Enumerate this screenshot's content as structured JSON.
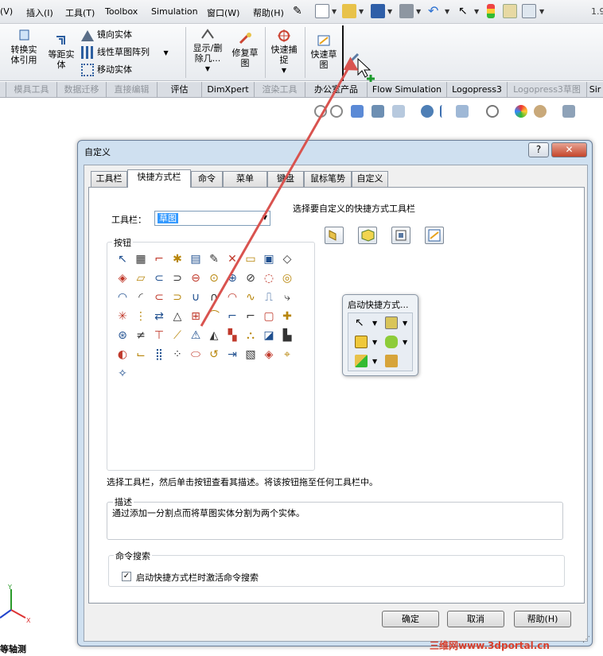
{
  "menubar": {
    "items": [
      "(V)",
      "插入(I)",
      "工具(T)",
      "Toolbox",
      "Simulation",
      "窗口(W)",
      "帮助(H)"
    ],
    "version_text": "1.9"
  },
  "ribbon": {
    "convert_entities": "转换实\n体引用",
    "offset_entities": "等距实\n体",
    "mirror_entities": "镜向实体",
    "linear_pattern": "线性草图阵列",
    "move_entities": "移动实体",
    "show_delete_relations": "显示/删\n除几...",
    "repair_sketch": "修复草\n图",
    "quick_snaps": "快速捕\n捉",
    "rapid_sketch": "快速草\n图"
  },
  "tabs": [
    {
      "label": "模具工具",
      "dim": true
    },
    {
      "label": "数据迁移",
      "dim": true
    },
    {
      "label": "直接编辑",
      "dim": true
    },
    {
      "label": "评估",
      "dim": false
    },
    {
      "label": "DimXpert",
      "dim": false
    },
    {
      "label": "渲染工具",
      "dim": true
    },
    {
      "label": "办公室产品",
      "dim": false
    },
    {
      "label": "Flow Simulation",
      "dim": false
    },
    {
      "label": "Logopress3",
      "dim": false
    },
    {
      "label": "Logopress3草图",
      "dim": true
    },
    {
      "label": "Sir",
      "dim": false
    }
  ],
  "dialog": {
    "title": "自定义",
    "help_btn": "?",
    "close_btn": "✕",
    "tabs": [
      "工具栏",
      "快捷方式栏",
      "命令",
      "菜单",
      "键盘",
      "鼠标笔势",
      "自定义"
    ],
    "active_tab": "快捷方式栏",
    "toolbar_label": "工具栏：",
    "toolbar_value": "草图",
    "select_toolbar_heading": "选择要自定义的快捷方式工具栏",
    "buttons_group": "按钮",
    "popup_title": "启动快捷方式...",
    "hint": "选择工具栏，然后单击按钮查看其描述。将该按钮拖至任何工具栏中。",
    "description_title": "描述",
    "description_text": "通过添加一分割点而将草图实体分割为两个实体。",
    "search_group": "命令搜索",
    "search_checkbox": "启动快捷方式栏时激活命令搜索",
    "search_checked": true,
    "ok": "确定",
    "cancel": "取消",
    "help": "帮助(H)"
  },
  "view": {
    "label": "等轴测"
  },
  "watermark": "三维网www.3dportal.cn",
  "colors": {
    "arrow": "#d9534f",
    "accent": "#3399ff",
    "dialog_frame": "#cfe0f0"
  }
}
